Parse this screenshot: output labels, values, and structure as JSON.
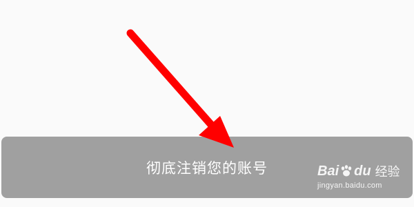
{
  "button": {
    "label": "彻底注销您的账号"
  },
  "watermark": {
    "brand_bai": "Bai",
    "brand_du": "du",
    "brand_jingyan": "经验",
    "url": "jingyan.baidu.com"
  },
  "colors": {
    "background": "#fafafa",
    "button_background": "#a0a0a0",
    "button_text": "#ffffff",
    "arrow": "#ff0000"
  },
  "icons": {
    "annotation": "red-arrow-icon",
    "watermark_logo": "baidu-paw-icon"
  }
}
